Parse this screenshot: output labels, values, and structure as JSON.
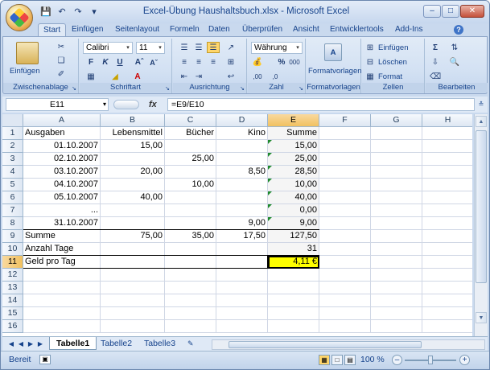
{
  "window": {
    "title": "Excel-Übung Haushaltsbuch.xlsx - Microsoft Excel"
  },
  "qat": [
    "save-icon",
    "undo-icon",
    "redo-icon",
    "customize-icon"
  ],
  "tabs": [
    "Start",
    "Einfügen",
    "Seitenlayout",
    "Formeln",
    "Daten",
    "Überprüfen",
    "Ansicht",
    "Entwicklertools",
    "Add-Ins"
  ],
  "ribbon": {
    "clipboard": {
      "label": "Zwischenablage",
      "paste": "Einfügen"
    },
    "font": {
      "label": "Schriftart",
      "name": "Calibri",
      "size": "11",
      "bold": "F",
      "italic": "K",
      "underline": "U"
    },
    "alignment": {
      "label": "Ausrichtung"
    },
    "number": {
      "label": "Zahl",
      "format": "Währung",
      "percent": "%",
      "thousands": "000",
      "inc_dec": ",00",
      "dec_dec": ",0"
    },
    "styles": {
      "label": "Formatvorlagen",
      "button": "Formatvorlagen"
    },
    "cells": {
      "label": "Zellen",
      "insert": "Einfügen",
      "delete": "Löschen",
      "format": "Format"
    },
    "editing": {
      "label": "Bearbeiten"
    }
  },
  "formula_bar": {
    "name_box": "E11",
    "fx": "fx",
    "formula": "=E9/E10"
  },
  "columns": [
    "A",
    "B",
    "C",
    "D",
    "E",
    "F",
    "G",
    "H"
  ],
  "rows": [
    "1",
    "2",
    "3",
    "4",
    "5",
    "6",
    "7",
    "8",
    "9",
    "10",
    "11",
    "12",
    "13",
    "14",
    "15",
    "16"
  ],
  "cells": {
    "r1": [
      "Ausgaben",
      "Lebensmittel",
      "Bücher",
      "Kino",
      "Summe"
    ],
    "r2": [
      "01.10.2007",
      "15,00",
      "",
      "",
      "15,00"
    ],
    "r3": [
      "02.10.2007",
      "",
      "25,00",
      "",
      "25,00"
    ],
    "r4": [
      "03.10.2007",
      "20,00",
      "",
      "8,50",
      "28,50"
    ],
    "r5": [
      "04.10.2007",
      "",
      "10,00",
      "",
      "10,00"
    ],
    "r6": [
      "05.10.2007",
      "40,00",
      "",
      "",
      "40,00"
    ],
    "r7": [
      "...",
      "",
      "",
      "",
      "0,00"
    ],
    "r8": [
      "31.10.2007",
      "",
      "",
      "9,00",
      "9,00"
    ],
    "r9": [
      "Summe",
      "75,00",
      "35,00",
      "17,50",
      "127,50"
    ],
    "r10": [
      "Anzahl Tage",
      "",
      "",
      "",
      "31"
    ],
    "r11": [
      "Geld pro Tag",
      "",
      "",
      "",
      "4,11 €"
    ]
  },
  "sheet_tabs": [
    "Tabelle1",
    "Tabelle2",
    "Tabelle3"
  ],
  "status": {
    "text": "Bereit",
    "zoom": "100 %"
  },
  "colors": {
    "selected_cell_fill": "#ffff00",
    "header_highlight": "#f1c15f"
  }
}
